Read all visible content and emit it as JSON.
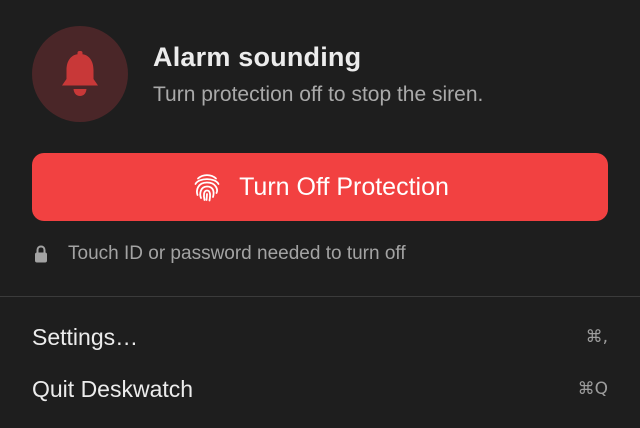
{
  "alert": {
    "icon": "bell-icon",
    "title": "Alarm sounding",
    "subtitle": "Turn protection off to stop the siren."
  },
  "primary_action": {
    "icon": "fingerprint-icon",
    "label": "Turn Off Protection",
    "color": "#f24141"
  },
  "auth_note": {
    "icon": "lock-icon",
    "text": "Touch ID or password needed to turn off"
  },
  "menu": {
    "items": [
      {
        "label": "Settings…",
        "shortcut": "⌘,"
      },
      {
        "label": "Quit Deskwatch",
        "shortcut": "⌘Q"
      }
    ]
  },
  "colors": {
    "background": "#1e1e1e",
    "alarm_circle": "#4a2628",
    "bell": "#d23c3c"
  }
}
